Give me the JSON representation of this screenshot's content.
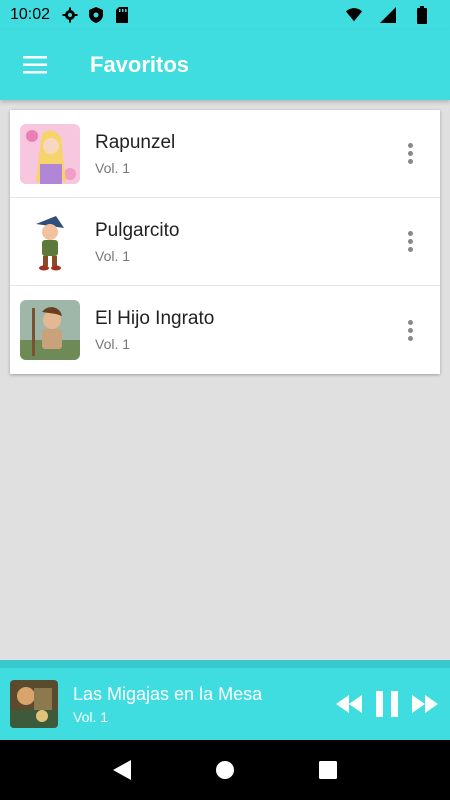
{
  "status_bar": {
    "time": "10:02",
    "icons_left": [
      "settings-icon",
      "shield-icon",
      "sd-card-icon"
    ],
    "icons_right": [
      "wifi-icon",
      "signal-icon",
      "battery-icon"
    ]
  },
  "app_bar": {
    "menu_icon": "hamburger-menu-icon",
    "title": "Favoritos",
    "color": "#3fdde0"
  },
  "favorites": [
    {
      "title": "Rapunzel",
      "volume": "Vol. 1",
      "thumb": "rapunzel-cover"
    },
    {
      "title": "Pulgarcito",
      "volume": "Vol. 1",
      "thumb": "pulgarcito-cover"
    },
    {
      "title": "El Hijo Ingrato",
      "volume": "Vol. 1",
      "thumb": "hijo-ingrato-cover"
    }
  ],
  "player": {
    "title": "Las Migajas en la Mesa",
    "volume": "Vol. 1",
    "controls": [
      "rewind-icon",
      "pause-icon",
      "fast-forward-icon"
    ]
  },
  "nav_bar": {
    "buttons": [
      "back-icon",
      "home-icon",
      "recents-icon"
    ]
  }
}
